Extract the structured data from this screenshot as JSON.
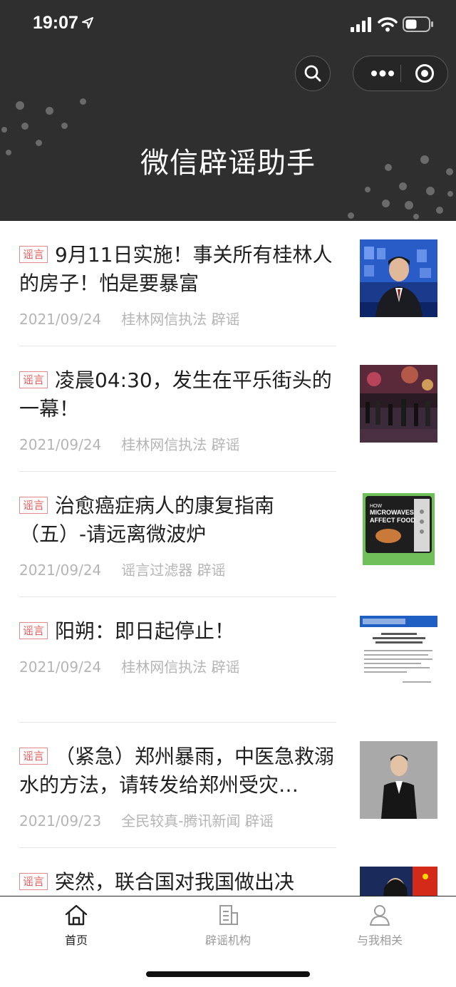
{
  "status_bar": {
    "time": "19:07"
  },
  "header": {
    "title": "微信辟谣助手"
  },
  "articles": [
    {
      "tag": "谣言",
      "title": "9月11日实施！事关所有桂林人的房子！怕是要暴富",
      "date": "2021/09/24",
      "source": "桂林网信执法 辟谣"
    },
    {
      "tag": "谣言",
      "title": "凌晨04:30，发生在平乐街头的一幕！",
      "date": "2021/09/24",
      "source": "桂林网信执法 辟谣"
    },
    {
      "tag": "谣言",
      "title": "治愈癌症病人的康复指南（五）-请远离微波炉",
      "date": "2021/09/24",
      "source": "谣言过滤器 辟谣",
      "thumb_text": [
        "HOW",
        "MICROWAVES",
        "AFFECT FOOD"
      ]
    },
    {
      "tag": "谣言",
      "title": "阳朔：即日起停止！",
      "date": "2021/09/24",
      "source": "桂林网信执法 辟谣"
    },
    {
      "tag": "谣言",
      "title": "（紧急）郑州暴雨，中医急救溺水的方法，请转发给郑州受灾…",
      "date": "2021/09/23",
      "source": "全民较真-腾讯新闻 辟谣"
    },
    {
      "tag": "谣言",
      "title": "突然，联合国对我国做出决",
      "date": "",
      "source": ""
    }
  ],
  "tabbar": {
    "items": [
      {
        "label": "首页",
        "icon": "home-icon",
        "active": true
      },
      {
        "label": "辟谣机构",
        "icon": "building-icon",
        "active": false
      },
      {
        "label": "与我相关",
        "icon": "user-icon",
        "active": false
      }
    ]
  },
  "colors": {
    "header_bg": "#2f2f2f",
    "tag_red": "#e06060",
    "meta_gray": "#b5b5b5"
  }
}
